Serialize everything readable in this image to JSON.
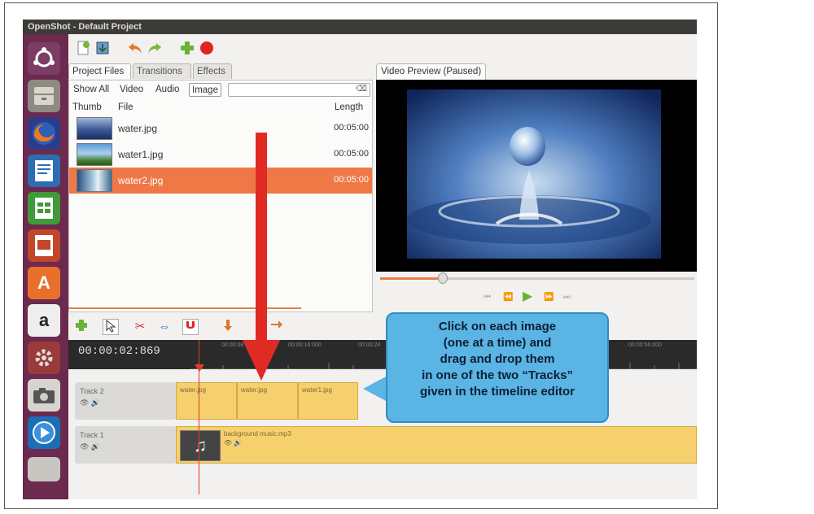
{
  "window": {
    "title": "OpenShot - Default Project"
  },
  "launcher": {
    "items": [
      "ubuntu-icon",
      "files-icon",
      "firefox-icon",
      "writer-icon",
      "calc-icon",
      "impress-icon",
      "software-center-icon",
      "amazon-icon",
      "settings-icon",
      "camera-icon",
      "openshot-icon"
    ],
    "amazon_glyph": "a",
    "store_glyph": "A"
  },
  "project_tabs": [
    "Project Files",
    "Transitions",
    "Effects"
  ],
  "filters": {
    "show_all": "Show All",
    "video": "Video",
    "audio": "Audio",
    "image": "Image",
    "active": "Image",
    "search_value": ""
  },
  "files": {
    "col_thumb": "Thumb",
    "col_file": "File",
    "col_length": "Length",
    "rows": [
      {
        "name": "water.jpg",
        "length": "00:05:00",
        "selected": false
      },
      {
        "name": "water1.jpg",
        "length": "00:05:00",
        "selected": false
      },
      {
        "name": "water2.jpg",
        "length": "00:05:00",
        "selected": true
      }
    ]
  },
  "preview": {
    "title": "Video Preview (Paused)",
    "seek_fraction": 0.2
  },
  "timeline": {
    "current_time": "00:00:02:869",
    "ruler_labels": [
      "00:00:08",
      "00:00:16:000",
      "00:00:24",
      "00:00:56:000"
    ],
    "tracks": [
      {
        "name": "Track 2",
        "clips": [
          "water.jpg",
          "water.jpg",
          "water1.jpg"
        ]
      },
      {
        "name": "Track 1",
        "clips": [
          "background music.mp3"
        ]
      }
    ]
  },
  "callout": {
    "lines": [
      "Click on each image",
      "(one at a time) and",
      "drag and drop them",
      "in one of the two “Tracks”",
      "given in the timeline editor"
    ]
  },
  "colors": {
    "selection": "#f07746",
    "launcher": "#6b2a4e",
    "clip": "#f6d06c",
    "arrow": "#e02a24",
    "callout": "#5ab4e4"
  }
}
